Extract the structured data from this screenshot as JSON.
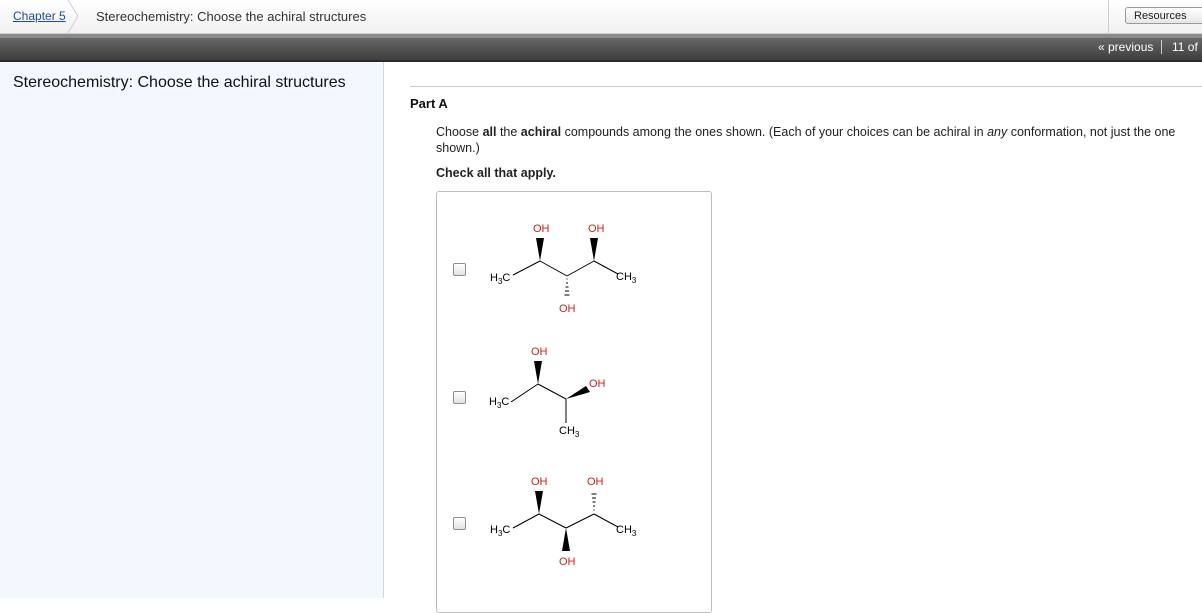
{
  "breadcrumb": {
    "chapter_link": "Chapter 5",
    "title": "Stereochemistry: Choose the achiral structures"
  },
  "header": {
    "resources_label": "Resources",
    "previous_label": "« previous",
    "page_counter": "11 of"
  },
  "sidebar": {
    "title": "Stereochemistry: Choose the achiral structures"
  },
  "main": {
    "part_label": "Part A",
    "question": {
      "t1": "Choose ",
      "b1": "all",
      "t2": " the ",
      "b2": "achiral",
      "t3": " compounds among the ones shown. (Each of your choices can be achiral in ",
      "i1": "any",
      "t4": " conformation, not just the one shown.)"
    },
    "instruction": "Check all that apply.",
    "choices": [
      {
        "checked": false,
        "labels": {
          "oh_top_left": "OH",
          "oh_top_right": "OH",
          "oh_bottom": "OH",
          "h3c": [
            "H",
            "3",
            "C"
          ],
          "ch3": [
            "CH",
            "3"
          ]
        }
      },
      {
        "checked": false,
        "labels": {
          "oh_top": "OH",
          "oh_right": "OH",
          "h3c": [
            "H",
            "3",
            "C"
          ],
          "ch3_bottom": [
            "CH",
            "3"
          ]
        }
      },
      {
        "checked": false,
        "labels": {
          "oh_top_left": "OH",
          "oh_top_right": "OH",
          "oh_bottom": "OH",
          "h3c": [
            "H",
            "3",
            "C"
          ],
          "ch3": [
            "CH",
            "3"
          ]
        }
      }
    ]
  },
  "colors": {
    "oxygen": "#cc1f1f",
    "link": "#1b4c9a",
    "nav_bar": "#4a4a4a",
    "sidebar_bg": "#f2f8fd"
  }
}
